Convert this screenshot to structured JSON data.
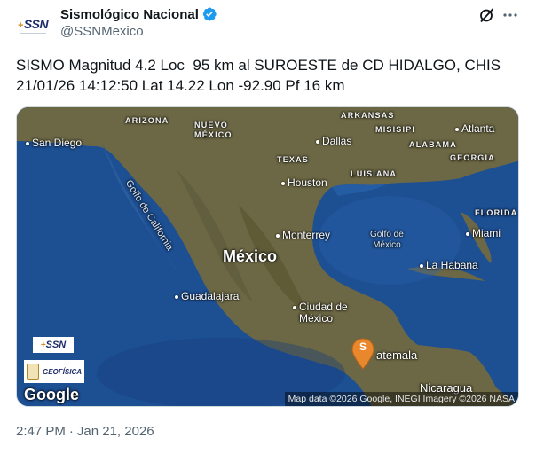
{
  "author": {
    "display_name": "Sismológico Nacional",
    "handle": "@SSNMexico",
    "avatar_text": "SSN",
    "verified": true
  },
  "tweet": {
    "line1": "SISMO Magnitud 4.2 Loc  95 km al SUROESTE de CD HIDALGO, CHIS",
    "line2": "21/01/26 14:12:50 Lat 14.22 Lon -92.90 Pf 16 km",
    "time": "2:47 PM",
    "separator": "·",
    "date": "Jan 21, 2026"
  },
  "map": {
    "country_label": "México",
    "states": [
      "ARIZONA",
      "NUEVO",
      "MÉXICO",
      "ARKANSAS",
      "MISISIPI",
      "ALABAMA",
      "GEORGIA",
      "TEXAS",
      "LUISIANA",
      "FLORIDA"
    ],
    "cities": [
      "San Diego",
      "Dallas",
      "Atlanta",
      "Houston",
      "Monterrey",
      "Miami",
      "La Habana",
      "Guadalajara",
      "Ciudad de",
      "México",
      "atemala",
      "Nicaragua"
    ],
    "water": {
      "gulf_california": "Golfo de California",
      "gulf_mexico_1": "Golfo de",
      "gulf_mexico_2": "México"
    },
    "marker_letter": "S",
    "badge_ssn": "SSN",
    "badge_geo": "GEOFÍSICA",
    "google": "Google",
    "attribution": "Map data ©2026 Google, INEGI Imagery ©2026 NASA",
    "colors": {
      "ocean": "#1d4f93",
      "land": "#6f6a46",
      "marker": "#e8872b"
    }
  },
  "icons": {
    "verified": "verified-badge-icon",
    "grok": "grok-icon",
    "more": "more-icon"
  }
}
